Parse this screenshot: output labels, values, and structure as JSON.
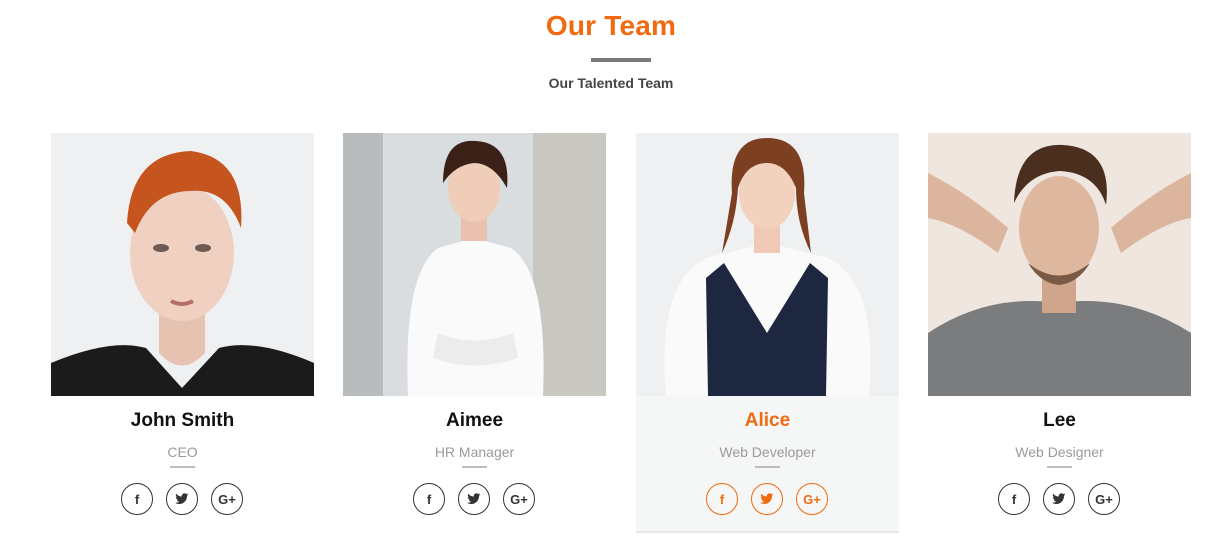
{
  "section": {
    "title": "Our Team",
    "subtitle": "Our Talented Team",
    "accent_color": "#f26a10"
  },
  "members": [
    {
      "name": "John Smith",
      "role": "CEO",
      "socials": [
        "facebook-icon",
        "twitter-icon",
        "google-plus-icon"
      ]
    },
    {
      "name": "Aimee",
      "role": "HR Manager",
      "socials": [
        "facebook-icon",
        "twitter-icon",
        "google-plus-icon"
      ]
    },
    {
      "name": "Alice",
      "role": "Web Developer",
      "highlighted": true,
      "socials": [
        "facebook-icon",
        "twitter-icon",
        "google-plus-icon"
      ]
    },
    {
      "name": "Lee",
      "role": "Web Designer",
      "socials": [
        "facebook-icon",
        "twitter-icon",
        "google-plus-icon"
      ]
    }
  ],
  "social_labels": {
    "facebook": "f",
    "google_plus": "G+"
  }
}
